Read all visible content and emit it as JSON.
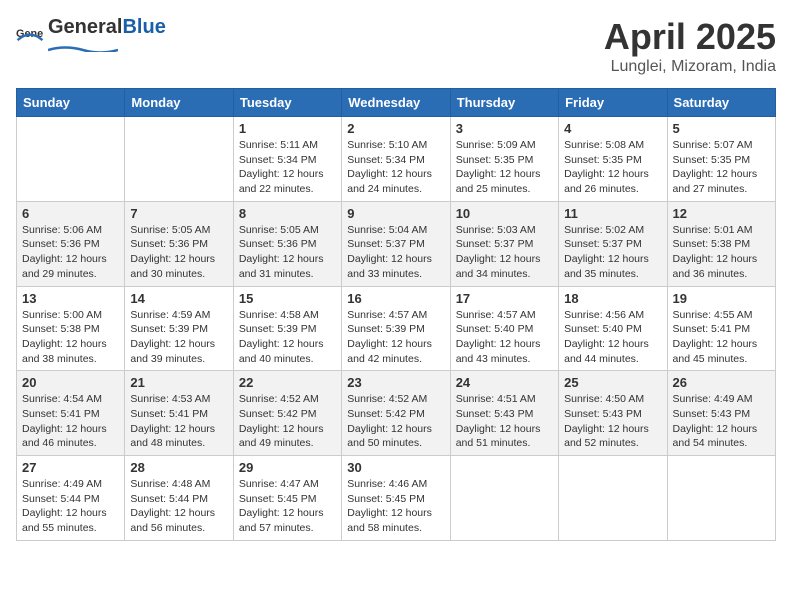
{
  "header": {
    "logo_general": "General",
    "logo_blue": "Blue",
    "month_title": "April 2025",
    "location": "Lunglei, Mizoram, India"
  },
  "days_of_week": [
    "Sunday",
    "Monday",
    "Tuesday",
    "Wednesday",
    "Thursday",
    "Friday",
    "Saturday"
  ],
  "weeks": [
    [
      {
        "day": "",
        "sunrise": "",
        "sunset": "",
        "daylight": ""
      },
      {
        "day": "",
        "sunrise": "",
        "sunset": "",
        "daylight": ""
      },
      {
        "day": "1",
        "sunrise": "Sunrise: 5:11 AM",
        "sunset": "Sunset: 5:34 PM",
        "daylight": "Daylight: 12 hours and 22 minutes."
      },
      {
        "day": "2",
        "sunrise": "Sunrise: 5:10 AM",
        "sunset": "Sunset: 5:34 PM",
        "daylight": "Daylight: 12 hours and 24 minutes."
      },
      {
        "day": "3",
        "sunrise": "Sunrise: 5:09 AM",
        "sunset": "Sunset: 5:35 PM",
        "daylight": "Daylight: 12 hours and 25 minutes."
      },
      {
        "day": "4",
        "sunrise": "Sunrise: 5:08 AM",
        "sunset": "Sunset: 5:35 PM",
        "daylight": "Daylight: 12 hours and 26 minutes."
      },
      {
        "day": "5",
        "sunrise": "Sunrise: 5:07 AM",
        "sunset": "Sunset: 5:35 PM",
        "daylight": "Daylight: 12 hours and 27 minutes."
      }
    ],
    [
      {
        "day": "6",
        "sunrise": "Sunrise: 5:06 AM",
        "sunset": "Sunset: 5:36 PM",
        "daylight": "Daylight: 12 hours and 29 minutes."
      },
      {
        "day": "7",
        "sunrise": "Sunrise: 5:05 AM",
        "sunset": "Sunset: 5:36 PM",
        "daylight": "Daylight: 12 hours and 30 minutes."
      },
      {
        "day": "8",
        "sunrise": "Sunrise: 5:05 AM",
        "sunset": "Sunset: 5:36 PM",
        "daylight": "Daylight: 12 hours and 31 minutes."
      },
      {
        "day": "9",
        "sunrise": "Sunrise: 5:04 AM",
        "sunset": "Sunset: 5:37 PM",
        "daylight": "Daylight: 12 hours and 33 minutes."
      },
      {
        "day": "10",
        "sunrise": "Sunrise: 5:03 AM",
        "sunset": "Sunset: 5:37 PM",
        "daylight": "Daylight: 12 hours and 34 minutes."
      },
      {
        "day": "11",
        "sunrise": "Sunrise: 5:02 AM",
        "sunset": "Sunset: 5:37 PM",
        "daylight": "Daylight: 12 hours and 35 minutes."
      },
      {
        "day": "12",
        "sunrise": "Sunrise: 5:01 AM",
        "sunset": "Sunset: 5:38 PM",
        "daylight": "Daylight: 12 hours and 36 minutes."
      }
    ],
    [
      {
        "day": "13",
        "sunrise": "Sunrise: 5:00 AM",
        "sunset": "Sunset: 5:38 PM",
        "daylight": "Daylight: 12 hours and 38 minutes."
      },
      {
        "day": "14",
        "sunrise": "Sunrise: 4:59 AM",
        "sunset": "Sunset: 5:39 PM",
        "daylight": "Daylight: 12 hours and 39 minutes."
      },
      {
        "day": "15",
        "sunrise": "Sunrise: 4:58 AM",
        "sunset": "Sunset: 5:39 PM",
        "daylight": "Daylight: 12 hours and 40 minutes."
      },
      {
        "day": "16",
        "sunrise": "Sunrise: 4:57 AM",
        "sunset": "Sunset: 5:39 PM",
        "daylight": "Daylight: 12 hours and 42 minutes."
      },
      {
        "day": "17",
        "sunrise": "Sunrise: 4:57 AM",
        "sunset": "Sunset: 5:40 PM",
        "daylight": "Daylight: 12 hours and 43 minutes."
      },
      {
        "day": "18",
        "sunrise": "Sunrise: 4:56 AM",
        "sunset": "Sunset: 5:40 PM",
        "daylight": "Daylight: 12 hours and 44 minutes."
      },
      {
        "day": "19",
        "sunrise": "Sunrise: 4:55 AM",
        "sunset": "Sunset: 5:41 PM",
        "daylight": "Daylight: 12 hours and 45 minutes."
      }
    ],
    [
      {
        "day": "20",
        "sunrise": "Sunrise: 4:54 AM",
        "sunset": "Sunset: 5:41 PM",
        "daylight": "Daylight: 12 hours and 46 minutes."
      },
      {
        "day": "21",
        "sunrise": "Sunrise: 4:53 AM",
        "sunset": "Sunset: 5:41 PM",
        "daylight": "Daylight: 12 hours and 48 minutes."
      },
      {
        "day": "22",
        "sunrise": "Sunrise: 4:52 AM",
        "sunset": "Sunset: 5:42 PM",
        "daylight": "Daylight: 12 hours and 49 minutes."
      },
      {
        "day": "23",
        "sunrise": "Sunrise: 4:52 AM",
        "sunset": "Sunset: 5:42 PM",
        "daylight": "Daylight: 12 hours and 50 minutes."
      },
      {
        "day": "24",
        "sunrise": "Sunrise: 4:51 AM",
        "sunset": "Sunset: 5:43 PM",
        "daylight": "Daylight: 12 hours and 51 minutes."
      },
      {
        "day": "25",
        "sunrise": "Sunrise: 4:50 AM",
        "sunset": "Sunset: 5:43 PM",
        "daylight": "Daylight: 12 hours and 52 minutes."
      },
      {
        "day": "26",
        "sunrise": "Sunrise: 4:49 AM",
        "sunset": "Sunset: 5:43 PM",
        "daylight": "Daylight: 12 hours and 54 minutes."
      }
    ],
    [
      {
        "day": "27",
        "sunrise": "Sunrise: 4:49 AM",
        "sunset": "Sunset: 5:44 PM",
        "daylight": "Daylight: 12 hours and 55 minutes."
      },
      {
        "day": "28",
        "sunrise": "Sunrise: 4:48 AM",
        "sunset": "Sunset: 5:44 PM",
        "daylight": "Daylight: 12 hours and 56 minutes."
      },
      {
        "day": "29",
        "sunrise": "Sunrise: 4:47 AM",
        "sunset": "Sunset: 5:45 PM",
        "daylight": "Daylight: 12 hours and 57 minutes."
      },
      {
        "day": "30",
        "sunrise": "Sunrise: 4:46 AM",
        "sunset": "Sunset: 5:45 PM",
        "daylight": "Daylight: 12 hours and 58 minutes."
      },
      {
        "day": "",
        "sunrise": "",
        "sunset": "",
        "daylight": ""
      },
      {
        "day": "",
        "sunrise": "",
        "sunset": "",
        "daylight": ""
      },
      {
        "day": "",
        "sunrise": "",
        "sunset": "",
        "daylight": ""
      }
    ]
  ]
}
